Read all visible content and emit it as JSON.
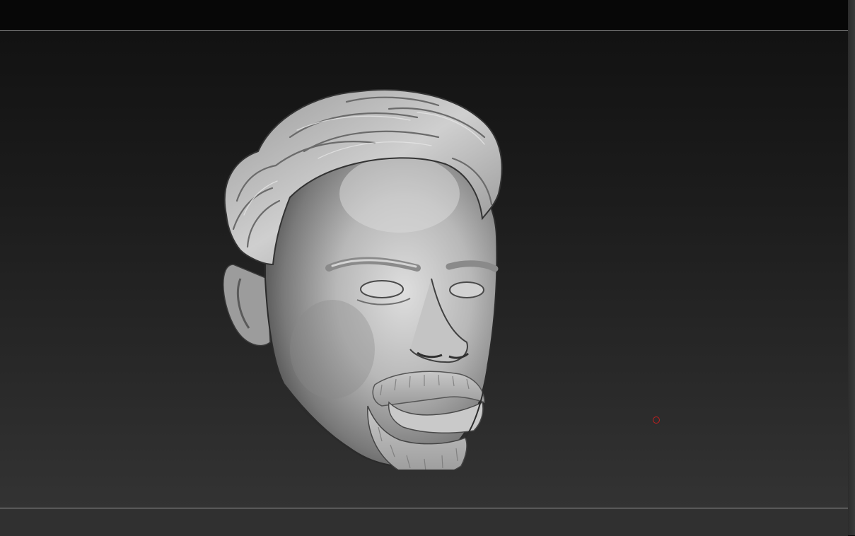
{
  "viewport": {
    "background_top": "#121212",
    "background_bottom": "#333333"
  },
  "model": {
    "material_color": "#bdbdbd",
    "icon": "sculpted-head-model"
  },
  "cursor": {
    "icon": "brush-cursor-ring",
    "color": "#c01f1f"
  }
}
